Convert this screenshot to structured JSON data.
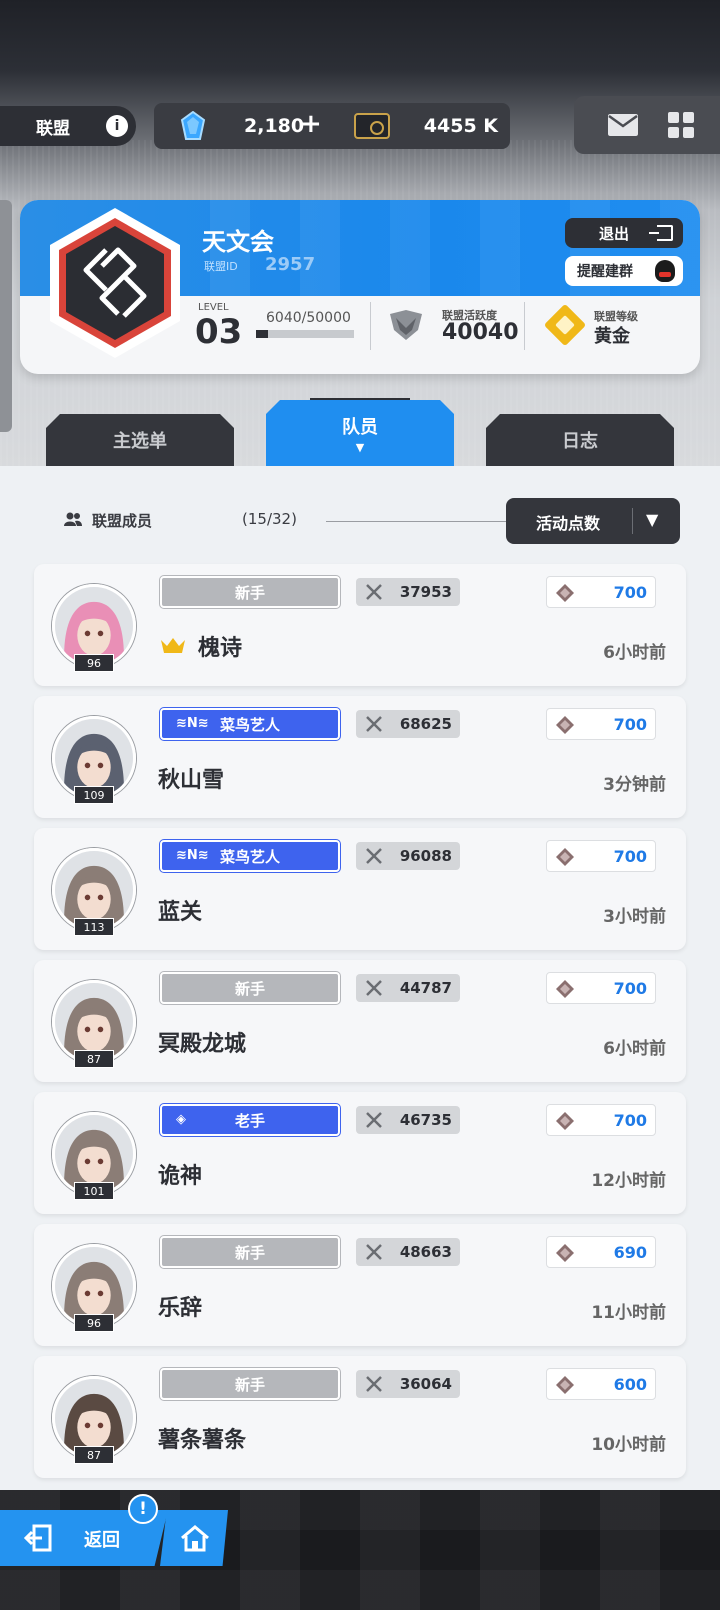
{
  "topbar": {
    "alliance_label": "联盟",
    "info_icon": "i",
    "gems": "2,180",
    "plus": "+",
    "gold": "4455 K"
  },
  "alliance": {
    "name": "天文会",
    "id_label": "联盟ID",
    "id_value": "2957",
    "exit_label": "退出",
    "remind_label": "提醒建群",
    "level_label": "LEVEL",
    "level_value": "03",
    "exp_text": "6040/50000",
    "exp_progress": 0.1208,
    "activity_label": "联盟活跃度",
    "activity_value": "40040",
    "tier_label": "联盟等级",
    "tier_value": "黄金"
  },
  "tabs": {
    "main_menu": "主选单",
    "members": "队员",
    "members_arrow": "▼",
    "log": "日志"
  },
  "members_header": {
    "label": "联盟成员",
    "count": "(15/32)",
    "sort_label": "活动点数",
    "sort_caret": "▼"
  },
  "members": [
    {
      "rank": "新手",
      "rank_style": "gray",
      "power": "37953",
      "points": "700",
      "name": "槐诗",
      "online": "6小时前",
      "level": "96",
      "crown": true,
      "avatar_color": "#e98fb6"
    },
    {
      "rank": "菜鸟艺人",
      "rank_style": "blue",
      "rank_icon": "≋N≋",
      "power": "68625",
      "points": "700",
      "name": "秋山雪",
      "online": "3分钟前",
      "level": "109",
      "crown": false,
      "avatar_color": "#5b6170"
    },
    {
      "rank": "菜鸟艺人",
      "rank_style": "blue",
      "rank_icon": "≋N≋",
      "power": "96088",
      "points": "700",
      "name": "蓝关",
      "online": "3小时前",
      "level": "113",
      "crown": false,
      "avatar_color": "#8b7d76"
    },
    {
      "rank": "新手",
      "rank_style": "gray",
      "power": "44787",
      "points": "700",
      "name": "冥殿龙城",
      "online": "6小时前",
      "level": "87",
      "crown": false,
      "avatar_color": "#8b7d76"
    },
    {
      "rank": "老手",
      "rank_style": "blue",
      "rank_icon": "◈",
      "power": "46735",
      "points": "700",
      "name": "诡神",
      "online": "12小时前",
      "level": "101",
      "crown": false,
      "avatar_color": "#8b7d76"
    },
    {
      "rank": "新手",
      "rank_style": "gray",
      "power": "48663",
      "points": "690",
      "name": "乐辞",
      "online": "11小时前",
      "level": "96",
      "crown": false,
      "avatar_color": "#8b7d76"
    },
    {
      "rank": "新手",
      "rank_style": "gray",
      "power": "36064",
      "points": "600",
      "name": "薯条薯条",
      "online": "10小时前",
      "level": "87",
      "crown": false,
      "avatar_color": "#5a4a42"
    }
  ],
  "bottom": {
    "back_label": "返回",
    "notice": "!"
  }
}
